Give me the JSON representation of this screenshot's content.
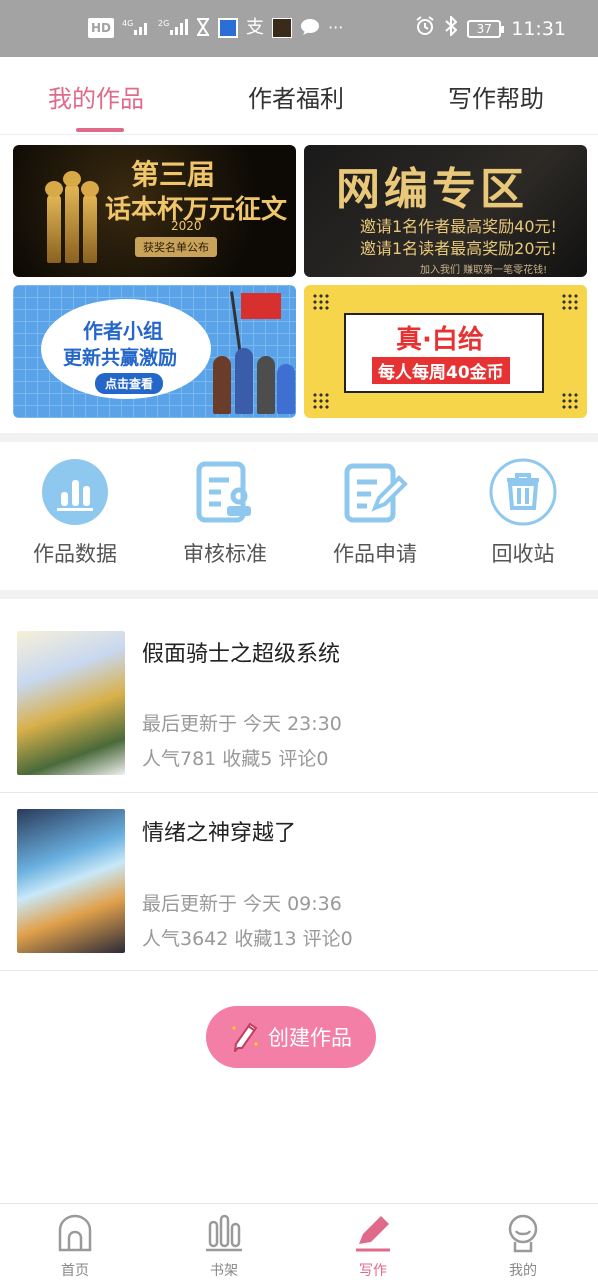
{
  "status_bar": {
    "left_icons": [
      "hd-icon",
      "4g-signal-icon",
      "2g-signal-icon",
      "hourglass-icon",
      "app-icon",
      "alipay-icon",
      "photo-icon",
      "chat-icon"
    ],
    "left_text": "HD 4G 2G",
    "more": "···",
    "battery": "37",
    "time": "11:31"
  },
  "tabs": [
    {
      "label": "我的作品",
      "active": true
    },
    {
      "label": "作者福利",
      "active": false
    },
    {
      "label": "写作帮助",
      "active": false
    }
  ],
  "banners": {
    "b1": {
      "line1": "第三届",
      "line2": "话本杯万元征文",
      "year": "2020",
      "button": "获奖名单公布"
    },
    "b2": {
      "line1": "网编专区",
      "line2": "邀请1名作者最高奖励40元!",
      "line3": "邀请1名读者最高奖励20元!",
      "line4": "加入我们 赚取第一笔零花钱!"
    },
    "b3": {
      "line1": "作者小组",
      "line2": "更新共赢激励",
      "button": "点击查看"
    },
    "b4": {
      "line1": "真·白给",
      "line2": "每人每周40金币"
    }
  },
  "tools": [
    {
      "label": "作品数据",
      "icon": "bar-chart-icon"
    },
    {
      "label": "审核标准",
      "icon": "review-document-icon"
    },
    {
      "label": "作品申请",
      "icon": "edit-document-icon"
    },
    {
      "label": "回收站",
      "icon": "trash-icon"
    }
  ],
  "works": [
    {
      "title": "假面骑士之超级系统",
      "updated": "最后更新于 今天 23:30",
      "stats": "人气781 收藏5 评论0"
    },
    {
      "title": "情绪之神穿越了",
      "updated": "最后更新于 今天 09:36",
      "stats": "人气3642 收藏13 评论0"
    }
  ],
  "create_button": "创建作品",
  "bottom_nav": [
    {
      "label": "首页",
      "icon": "home-icon",
      "active": false
    },
    {
      "label": "书架",
      "icon": "bookshelf-icon",
      "active": false
    },
    {
      "label": "写作",
      "icon": "pen-icon",
      "active": true
    },
    {
      "label": "我的",
      "icon": "profile-icon",
      "active": false
    }
  ],
  "colors": {
    "accent": "#e06a8a",
    "create_button": "#f37fa6",
    "tool_icon": "#8fc8ee",
    "status_bar": "#a3a3a3"
  }
}
